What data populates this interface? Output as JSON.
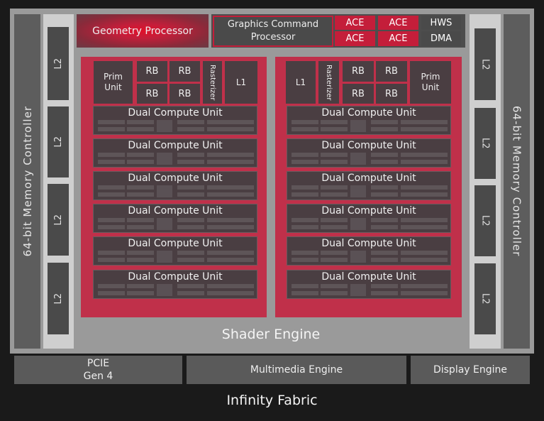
{
  "memory_controller_left": "64-bit Memory Controller",
  "memory_controller_right": "64-bit Memory Controller",
  "l2_label": "L2",
  "geometry_processor": "Geometry Processor",
  "graphics_command_processor": "Graphics Command Processor",
  "ace_label": "ACE",
  "hws_label": "HWS",
  "dma_label": "DMA",
  "prim_unit": "Prim Unit",
  "rb_label": "RB",
  "rasterizer": "Rasterizer",
  "l1_label": "L1",
  "dual_compute_unit": "Dual Compute Unit",
  "shader_engine": "Shader Engine",
  "pcie": "PCIE Gen 4",
  "multimedia_engine": "Multimedia Engine",
  "display_engine": "Display Engine",
  "infinity_fabric": "Infinity Fabric",
  "colors": {
    "accent_red": "#c41e3a",
    "block_dark": "#4a3e42",
    "panel_grey": "#9a9a9a"
  }
}
